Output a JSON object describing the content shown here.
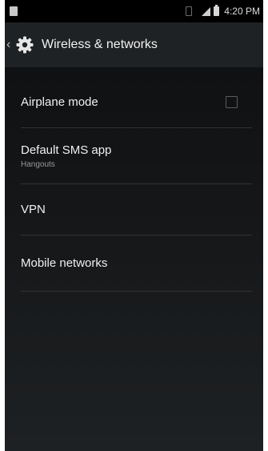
{
  "status_bar": {
    "time": "4:20 PM"
  },
  "action_bar": {
    "back_icon": "chevron-left-icon",
    "settings_icon": "gear-icon",
    "title": "Wireless & networks"
  },
  "settings": [
    {
      "title": "Airplane mode",
      "checked": false
    },
    {
      "title": "Default SMS app",
      "subtitle": "Hangouts"
    },
    {
      "title": "VPN"
    },
    {
      "title": "Mobile networks"
    }
  ],
  "colors": {
    "background_top": "#0d0e0f",
    "background_bottom": "#1e2123",
    "action_bar": "#1f2224",
    "divider": "#2f3234",
    "text_primary": "#f0f0f0",
    "text_secondary": "#9a9a9a"
  }
}
